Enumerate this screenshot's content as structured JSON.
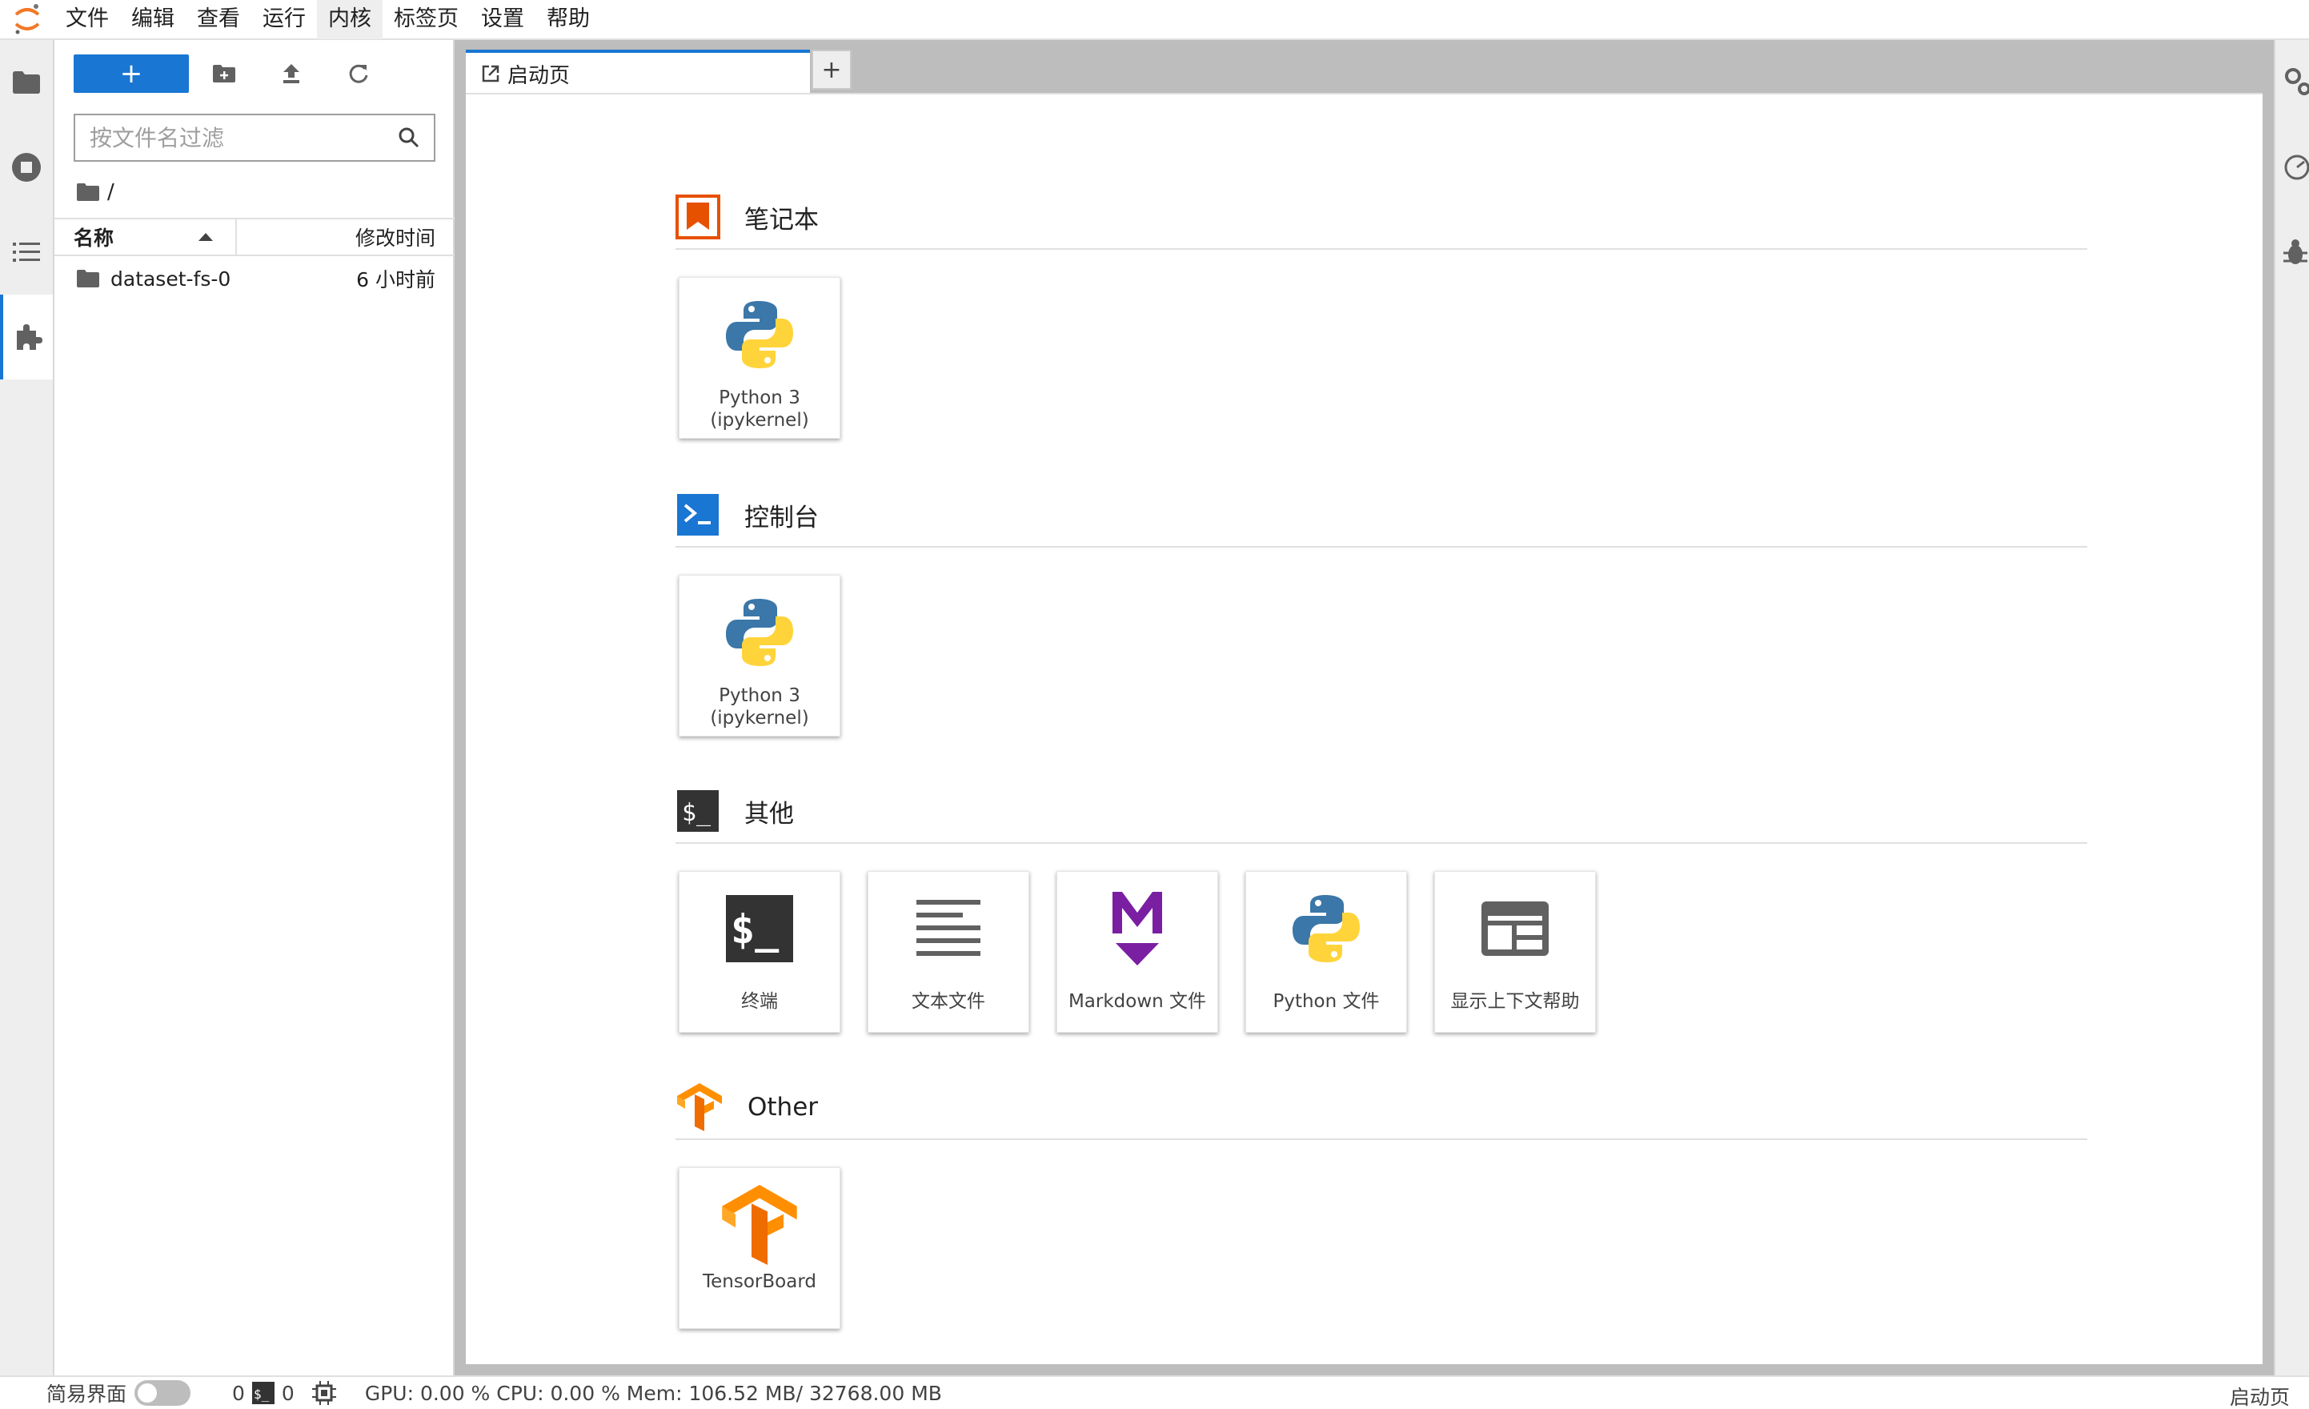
{
  "menubar": {
    "items": [
      "文件",
      "编辑",
      "查看",
      "运行",
      "内核",
      "标签页",
      "设置",
      "帮助"
    ],
    "active_index": 4
  },
  "left_sidebar": {
    "icons": [
      "folder-icon",
      "running-icon",
      "toc-icon",
      "extension-icon"
    ],
    "active_index": 3
  },
  "file_browser": {
    "new_button_label": "+",
    "filter_placeholder": "按文件名过滤",
    "breadcrumb": "/",
    "columns": {
      "name": "名称",
      "modified": "修改时间"
    },
    "files": [
      {
        "name": "dataset-fs-0",
        "modified": "6 小时前",
        "type": "folder"
      }
    ]
  },
  "tabs": {
    "active_label": "启动页",
    "add_label": "+"
  },
  "launcher": {
    "sections": [
      {
        "title": "笔记本",
        "icon": "notebook-icon",
        "cards": [
          {
            "label": "Python 3\n(ipykernel)",
            "icon": "python-icon"
          }
        ]
      },
      {
        "title": "控制台",
        "icon": "console-icon",
        "cards": [
          {
            "label": "Python 3\n(ipykernel)",
            "icon": "python-icon"
          }
        ]
      },
      {
        "title": "其他",
        "icon": "terminal-icon",
        "cards": [
          {
            "label": "终端",
            "icon": "terminal-icon"
          },
          {
            "label": "文本文件",
            "icon": "text-file-icon"
          },
          {
            "label": "Markdown 文件",
            "icon": "markdown-icon"
          },
          {
            "label": "Python 文件",
            "icon": "python-icon"
          },
          {
            "label": "显示上下文帮助",
            "icon": "context-help-icon"
          }
        ]
      },
      {
        "title": "Other",
        "icon": "tensorflow-icon",
        "cards": [
          {
            "label": "TensorBoard",
            "icon": "tensorflow-icon"
          }
        ]
      }
    ]
  },
  "right_sidebar": {
    "icons": [
      "property-inspector-icon",
      "resource-usage-icon",
      "debugger-icon"
    ]
  },
  "statusbar": {
    "simple_mode_label": "简易界面",
    "kernels_count": "0",
    "terminals_count": "0",
    "resources": "GPU: 0.00 % CPU: 0.00 % Mem: 106.52 MB/ 32768.00 MB",
    "right_label": "启动页"
  },
  "colors": {
    "accent": "#1976d2",
    "notebook_orange": "#e65100",
    "markdown_purple": "#7b1fa2",
    "terminal_dark": "#333333"
  }
}
